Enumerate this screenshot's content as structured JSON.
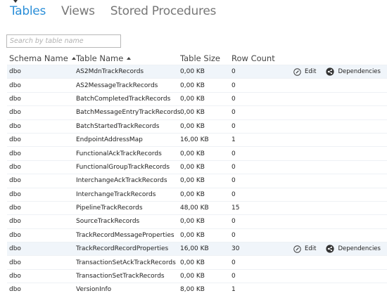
{
  "tabs": [
    {
      "label": "Tables",
      "active": true
    },
    {
      "label": "Views",
      "active": false
    },
    {
      "label": "Stored Procedures",
      "active": false
    }
  ],
  "search": {
    "placeholder": "Search by table name",
    "value": ""
  },
  "columns": {
    "schema": "Schema Name",
    "table": "Table Name",
    "size": "Table Size",
    "count": "Row Count"
  },
  "actions": {
    "edit": "Edit",
    "dependencies": "Dependencies"
  },
  "rows": [
    {
      "schema": "dbo",
      "table": "AS2MdnTrackRecords",
      "size": "0,00 KB",
      "count": "0",
      "hover": true
    },
    {
      "schema": "dbo",
      "table": "AS2MessageTrackRecords",
      "size": "0,00 KB",
      "count": "0"
    },
    {
      "schema": "dbo",
      "table": "BatchCompletedTrackRecords",
      "size": "0,00 KB",
      "count": "0"
    },
    {
      "schema": "dbo",
      "table": "BatchMessageEntryTrackRecords",
      "size": "0,00 KB",
      "count": "0"
    },
    {
      "schema": "dbo",
      "table": "BatchStartedTrackRecords",
      "size": "0,00 KB",
      "count": "0"
    },
    {
      "schema": "dbo",
      "table": "EndpointAddressMap",
      "size": "16,00 KB",
      "count": "1"
    },
    {
      "schema": "dbo",
      "table": "FunctionalAckTrackRecords",
      "size": "0,00 KB",
      "count": "0"
    },
    {
      "schema": "dbo",
      "table": "FunctionalGroupTrackRecords",
      "size": "0,00 KB",
      "count": "0"
    },
    {
      "schema": "dbo",
      "table": "InterchangeAckTrackRecords",
      "size": "0,00 KB",
      "count": "0"
    },
    {
      "schema": "dbo",
      "table": "InterchangeTrackRecords",
      "size": "0,00 KB",
      "count": "0"
    },
    {
      "schema": "dbo",
      "table": "PipelineTrackRecords",
      "size": "48,00 KB",
      "count": "15"
    },
    {
      "schema": "dbo",
      "table": "SourceTrackRecords",
      "size": "0,00 KB",
      "count": "0"
    },
    {
      "schema": "dbo",
      "table": "TrackRecordMessageProperties",
      "size": "0,00 KB",
      "count": "0"
    },
    {
      "schema": "dbo",
      "table": "TrackRecordRecordProperties",
      "size": "16,00 KB",
      "count": "30",
      "hover": true
    },
    {
      "schema": "dbo",
      "table": "TransactionSetAckTrackRecords",
      "size": "0,00 KB",
      "count": "0"
    },
    {
      "schema": "dbo",
      "table": "TransactionSetTrackRecords",
      "size": "0,00 KB",
      "count": "0"
    },
    {
      "schema": "dbo",
      "table": "VersionInfo",
      "size": "8,00 KB",
      "count": "1"
    }
  ],
  "colors": {
    "accent": "#2a8ed8",
    "row_highlight": "#f0f5fa"
  },
  "icons": {
    "edit": "edit-circle-icon",
    "dependencies": "share-nodes-icon",
    "sort": "sort-ascending-icon"
  }
}
